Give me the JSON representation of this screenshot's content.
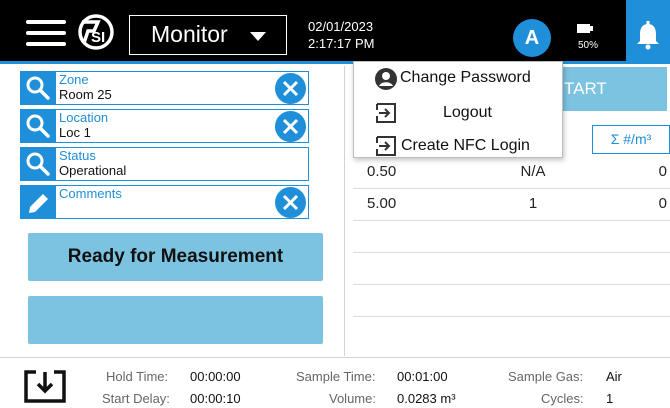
{
  "header": {
    "mode_label": "Monitor",
    "date": "02/01/2023",
    "time": "2:17:17 PM",
    "user_initial": "A",
    "battery_percent": "50%",
    "icons": [
      "menu-icon",
      "tsi-logo",
      "chevron-down-icon",
      "battery-icon",
      "bell-icon"
    ],
    "accent_color": "#1e8fd8"
  },
  "fields": [
    {
      "label": "Zone",
      "value": "Room 25",
      "icon": "search-icon",
      "clearable": true
    },
    {
      "label": "Location",
      "value": "Loc 1",
      "icon": "search-icon",
      "clearable": true
    },
    {
      "label": "Status",
      "value": "Operational",
      "icon": "search-icon",
      "clearable": false
    },
    {
      "label": "Comments",
      "value": "",
      "icon": "pencil-icon",
      "clearable": true
    }
  ],
  "actions": {
    "ready_label": "Ready for Measurement",
    "second_label": "",
    "start_label": "TART",
    "sum_label": "Σ #/m³"
  },
  "user_menu": {
    "items": [
      {
        "label": "Change Password",
        "icon": "user-icon"
      },
      {
        "label": "Logout",
        "icon": "logout-icon"
      },
      {
        "label": "Create NFC Login",
        "icon": "login-icon"
      }
    ]
  },
  "table": {
    "rows": [
      {
        "size": "0.50",
        "value": "N/A",
        "sum": "0"
      },
      {
        "size": "5.00",
        "value": "1",
        "sum": "0"
      },
      {
        "size": "",
        "value": "",
        "sum": ""
      },
      {
        "size": "",
        "value": "",
        "sum": ""
      },
      {
        "size": "",
        "value": "",
        "sum": ""
      }
    ]
  },
  "footer": {
    "hold_time_label": "Hold Time:",
    "hold_time": "00:00:00",
    "start_delay_label": "Start Delay:",
    "start_delay": "00:00:10",
    "sample_time_label": "Sample Time:",
    "sample_time": "00:01:00",
    "volume_label": "Volume:",
    "volume": "0.0283 m³",
    "sample_gas_label": "Sample Gas:",
    "sample_gas": "Air",
    "cycles_label": "Cycles:",
    "cycles": "1"
  }
}
